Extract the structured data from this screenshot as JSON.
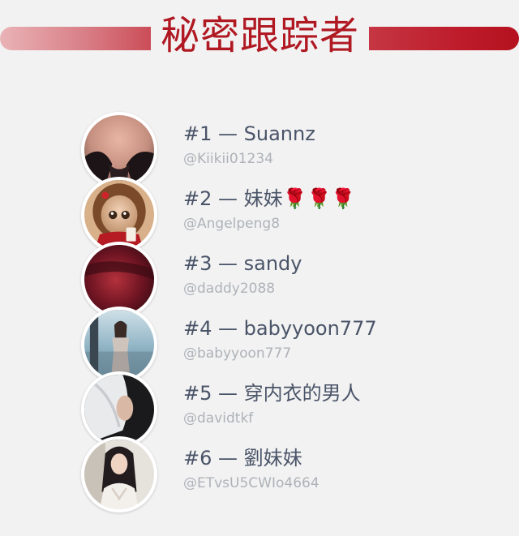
{
  "header": {
    "title": "秘密跟踪者",
    "accent_color_light": "#e9b3b6",
    "accent_color_dark": "#b5111f",
    "title_color": "#b01822"
  },
  "trackers": [
    {
      "label": "#1 — Suannz",
      "handle": "@Kiikii01234",
      "avatar_icon": "user-photo-avatar"
    },
    {
      "label": "#2 — 妹妹🌹🌹🌹",
      "handle": "@Angelpeng8",
      "avatar_icon": "cartoon-girl-avatar"
    },
    {
      "label": "#3 — sandy",
      "handle": "@daddy2088",
      "avatar_icon": "dark-red-avatar"
    },
    {
      "label": "#4 — babyyoon777",
      "handle": "@babyyoon777",
      "avatar_icon": "woman-city-avatar"
    },
    {
      "label": "#5 — 穿内衣的男人",
      "handle": "@davidtkf",
      "avatar_icon": "white-fabric-avatar"
    },
    {
      "label": "#6 — 劉妹妹",
      "handle": "@ETvsU5CWIo4664",
      "avatar_icon": "woman-portrait-avatar"
    }
  ],
  "colors": {
    "background": "#f2f2f2",
    "name_text": "#4a5468",
    "handle_text": "#aeb2b8"
  }
}
